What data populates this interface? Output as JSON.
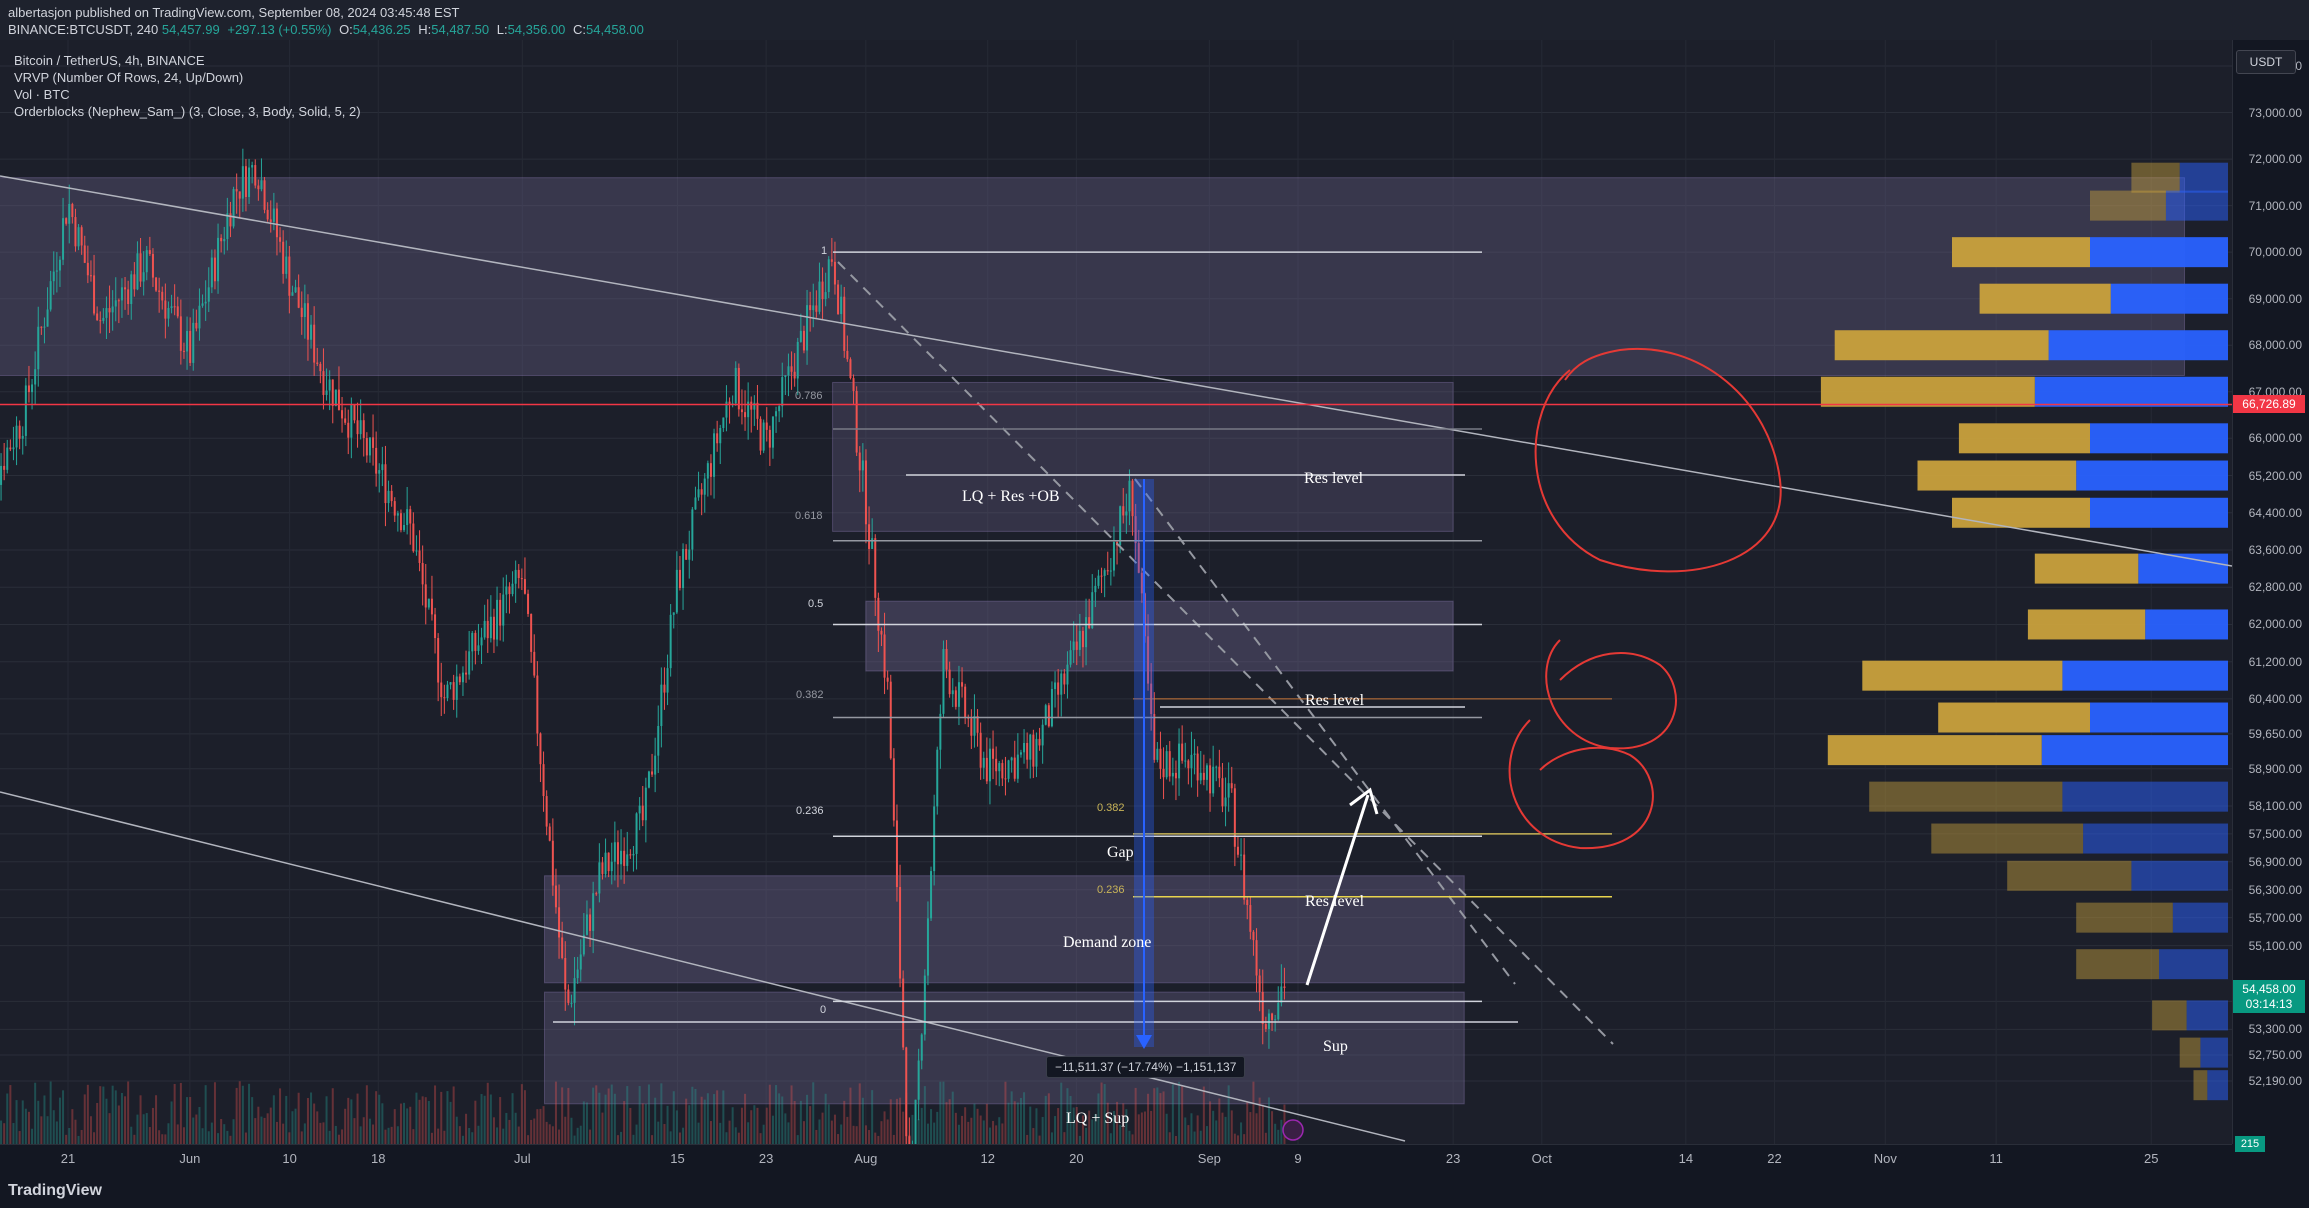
{
  "header": {
    "publish_line": "albertasjon published on TradingView.com, September 08, 2024 03:45:48 EST",
    "symbol_line": "BINANCE:BTCUSDT, 240",
    "last": "54,457.99",
    "change": "+297.13 (+0.55%)",
    "o_label": "O:",
    "o": "54,436.25",
    "h_label": "H:",
    "h": "54,487.50",
    "l_label": "L:",
    "l": "54,356.00",
    "c_label": "C:",
    "c": "54,458.00"
  },
  "legend": {
    "title": "Bitcoin / TetherUS, 4h, BINANCE",
    "vrvp": "VRVP (Number Of Rows, 24, Up/Down)",
    "vol": "Vol · BTC",
    "orderblocks": "Orderblocks (Nephew_Sam_) (3, Close, 3, Body, Solid, 5, 2)"
  },
  "currency_badge": "USDT",
  "price_axis_labels": [
    "74,000.00",
    "73,000.00",
    "72,000.00",
    "71,000.00",
    "70,000.00",
    "69,000.00",
    "68,000.00",
    "67,000.00",
    "66,000.00",
    "65,200.00",
    "64,400.00",
    "63,600.00",
    "62,800.00",
    "62,000.00",
    "61,200.00",
    "60,400.00",
    "59,650.00",
    "58,900.00",
    "58,100.00",
    "57,500.00",
    "56,900.00",
    "56,300.00",
    "55,700.00",
    "55,100.00",
    "53,900.00",
    "53,300.00",
    "52,750.00",
    "52,190.00"
  ],
  "price_badges": {
    "hline": "66,726.89",
    "current": "54,458.00",
    "countdown": "03:14:13",
    "volume": "215"
  },
  "time_axis_labels": [
    "21",
    "Jun",
    "10",
    "18",
    "Jul",
    "15",
    "23",
    "Aug",
    "12",
    "20",
    "Sep",
    "9",
    "23",
    "Oct",
    "14",
    "22",
    "Nov",
    "11",
    "25"
  ],
  "fib_labels": {
    "f1": "1",
    "f786": "0.786",
    "f618": "0.618",
    "f5": "0.5",
    "f382": "0.382",
    "f236": "0.236",
    "f0": "0",
    "y382": "0.382",
    "y236": "0.236"
  },
  "annotations": {
    "lq_res_ob": "LQ + Res +OB",
    "res_level_1": "Res level",
    "res_level_2": "Res level",
    "res_level_3": "Res level",
    "gap": "Gap",
    "demand_zone": "Demand zone",
    "sup": "Sup",
    "lq_sup": "LQ + Sup"
  },
  "measure_label": "−11,511.37 (−17.74%) −1,151,137",
  "footer": {
    "logo": "TradingView"
  },
  "colors": {
    "up": "#26a69a",
    "down": "#ef5350",
    "hline": "#f23645",
    "vp_up": "#2962ff",
    "vp_down": "#c9a13c",
    "accent_badge": "#089981"
  },
  "chart_data": {
    "type": "candlestick",
    "symbol": "BTCUSDT",
    "interval": "4h",
    "exchange": "BINANCE",
    "x_range": [
      "May 13 2024",
      "Nov 30 2024"
    ],
    "ylim": [
      51700,
      75000
    ],
    "price_path": [
      {
        "x": "May 13",
        "y": 64500
      },
      {
        "x": "May 17",
        "y": 66500
      },
      {
        "x": "May 21",
        "y": 71100
      },
      {
        "x": "May 24",
        "y": 68500
      },
      {
        "x": "May 28",
        "y": 69800
      },
      {
        "x": "Jun 1",
        "y": 67800
      },
      {
        "x": "Jun 5",
        "y": 71300
      },
      {
        "x": "Jun 7",
        "y": 71900
      },
      {
        "x": "Jun 10",
        "y": 69400
      },
      {
        "x": "Jun 13",
        "y": 67400
      },
      {
        "x": "Jun 18",
        "y": 65300
      },
      {
        "x": "Jun 21",
        "y": 64000
      },
      {
        "x": "Jun 24",
        "y": 60400
      },
      {
        "x": "Jun 27",
        "y": 61600
      },
      {
        "x": "Jul 1",
        "y": 63000
      },
      {
        "x": "Jul 5",
        "y": 53700
      },
      {
        "x": "Jul 8",
        "y": 56600
      },
      {
        "x": "Jul 12",
        "y": 57800
      },
      {
        "x": "Jul 15",
        "y": 62900
      },
      {
        "x": "Jul 20",
        "y": 67200
      },
      {
        "x": "Jul 23",
        "y": 65900
      },
      {
        "x": "Jul 29",
        "y": 70000
      },
      {
        "x": "Aug 1",
        "y": 64600
      },
      {
        "x": "Aug 3",
        "y": 60500
      },
      {
        "x": "Aug 5",
        "y": 49500
      },
      {
        "x": "Aug 8",
        "y": 61200
      },
      {
        "x": "Aug 12",
        "y": 58900
      },
      {
        "x": "Aug 16",
        "y": 59200
      },
      {
        "x": "Aug 20",
        "y": 61400
      },
      {
        "x": "Aug 25",
        "y": 64900
      },
      {
        "x": "Aug 27",
        "y": 59000
      },
      {
        "x": "Aug 31",
        "y": 59100
      },
      {
        "x": "Sep 3",
        "y": 58100
      },
      {
        "x": "Sep 6",
        "y": 53500
      },
      {
        "x": "Sep 8",
        "y": 54458
      }
    ],
    "last_close": 54458.0,
    "horizontal_line": 66726.89,
    "fib_retracement": {
      "high": 70000,
      "low": 53900,
      "levels": [
        0,
        0.236,
        0.382,
        0.5,
        0.618,
        0.786,
        1
      ]
    },
    "price_range_measure": {
      "change": -11511.37,
      "percent": -17.74,
      "volume": -1151137
    },
    "volume_profile": {
      "type": "bar",
      "rows": [
        {
          "price": 71600,
          "up": 0.35,
          "down": 0.35
        },
        {
          "price": 71000,
          "up": 0.45,
          "down": 0.55
        },
        {
          "price": 70000,
          "up": 1.0,
          "down": 1.0
        },
        {
          "price": 69000,
          "up": 0.85,
          "down": 0.95
        },
        {
          "price": 68000,
          "up": 1.3,
          "down": 1.55
        },
        {
          "price": 67000,
          "up": 1.4,
          "down": 1.55
        },
        {
          "price": 66000,
          "up": 1.0,
          "down": 0.95
        },
        {
          "price": 65200,
          "up": 1.1,
          "down": 1.15
        },
        {
          "price": 64400,
          "up": 1.0,
          "down": 1.0
        },
        {
          "price": 63200,
          "up": 0.65,
          "down": 0.75
        },
        {
          "price": 62000,
          "up": 0.6,
          "down": 0.85
        },
        {
          "price": 60900,
          "up": 1.2,
          "down": 1.45
        },
        {
          "price": 60000,
          "up": 1.0,
          "down": 1.1
        },
        {
          "price": 59300,
          "up": 1.35,
          "down": 1.55
        },
        {
          "price": 58300,
          "up": 1.2,
          "down": 1.4
        },
        {
          "price": 57400,
          "up": 1.05,
          "down": 1.1
        },
        {
          "price": 56600,
          "up": 0.7,
          "down": 0.9
        },
        {
          "price": 55700,
          "up": 0.4,
          "down": 0.7
        },
        {
          "price": 54700,
          "up": 0.5,
          "down": 0.6
        },
        {
          "price": 53600,
          "up": 0.3,
          "down": 0.25
        },
        {
          "price": 52800,
          "up": 0.2,
          "down": 0.15
        },
        {
          "price": 52100,
          "up": 0.15,
          "down": 0.1
        }
      ]
    }
  }
}
